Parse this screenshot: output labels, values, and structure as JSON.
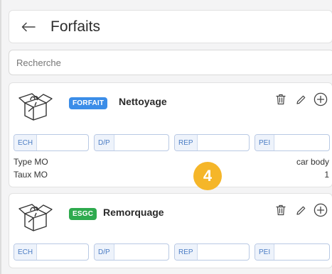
{
  "header": {
    "title": "Forfaits",
    "back_icon": "arrow-left-icon"
  },
  "search": {
    "placeholder": "Recherche",
    "value": ""
  },
  "cards": [
    {
      "badge": "FORFAIT",
      "badge_color": "#3b8de8",
      "name": "Nettoyage",
      "fields": [
        {
          "label": "ECH",
          "value": ""
        },
        {
          "label": "D/P",
          "value": ""
        },
        {
          "label": "REP",
          "value": ""
        },
        {
          "label": "PEI",
          "value": ""
        }
      ],
      "details": [
        {
          "label": "Type MO",
          "value": "car body"
        },
        {
          "label": "Taux MO",
          "value": "1"
        }
      ]
    },
    {
      "badge": "ESGC",
      "badge_color": "#2eaa4e",
      "name": "Remorquage",
      "fields": [
        {
          "label": "ECH",
          "value": ""
        },
        {
          "label": "D/P",
          "value": ""
        },
        {
          "label": "REP",
          "value": ""
        },
        {
          "label": "PEI",
          "value": ""
        }
      ]
    }
  ],
  "step_badge": "4",
  "colors": {
    "accent": "#3b8de8",
    "step": "#f5b629",
    "corner": "#1e3f8a"
  }
}
